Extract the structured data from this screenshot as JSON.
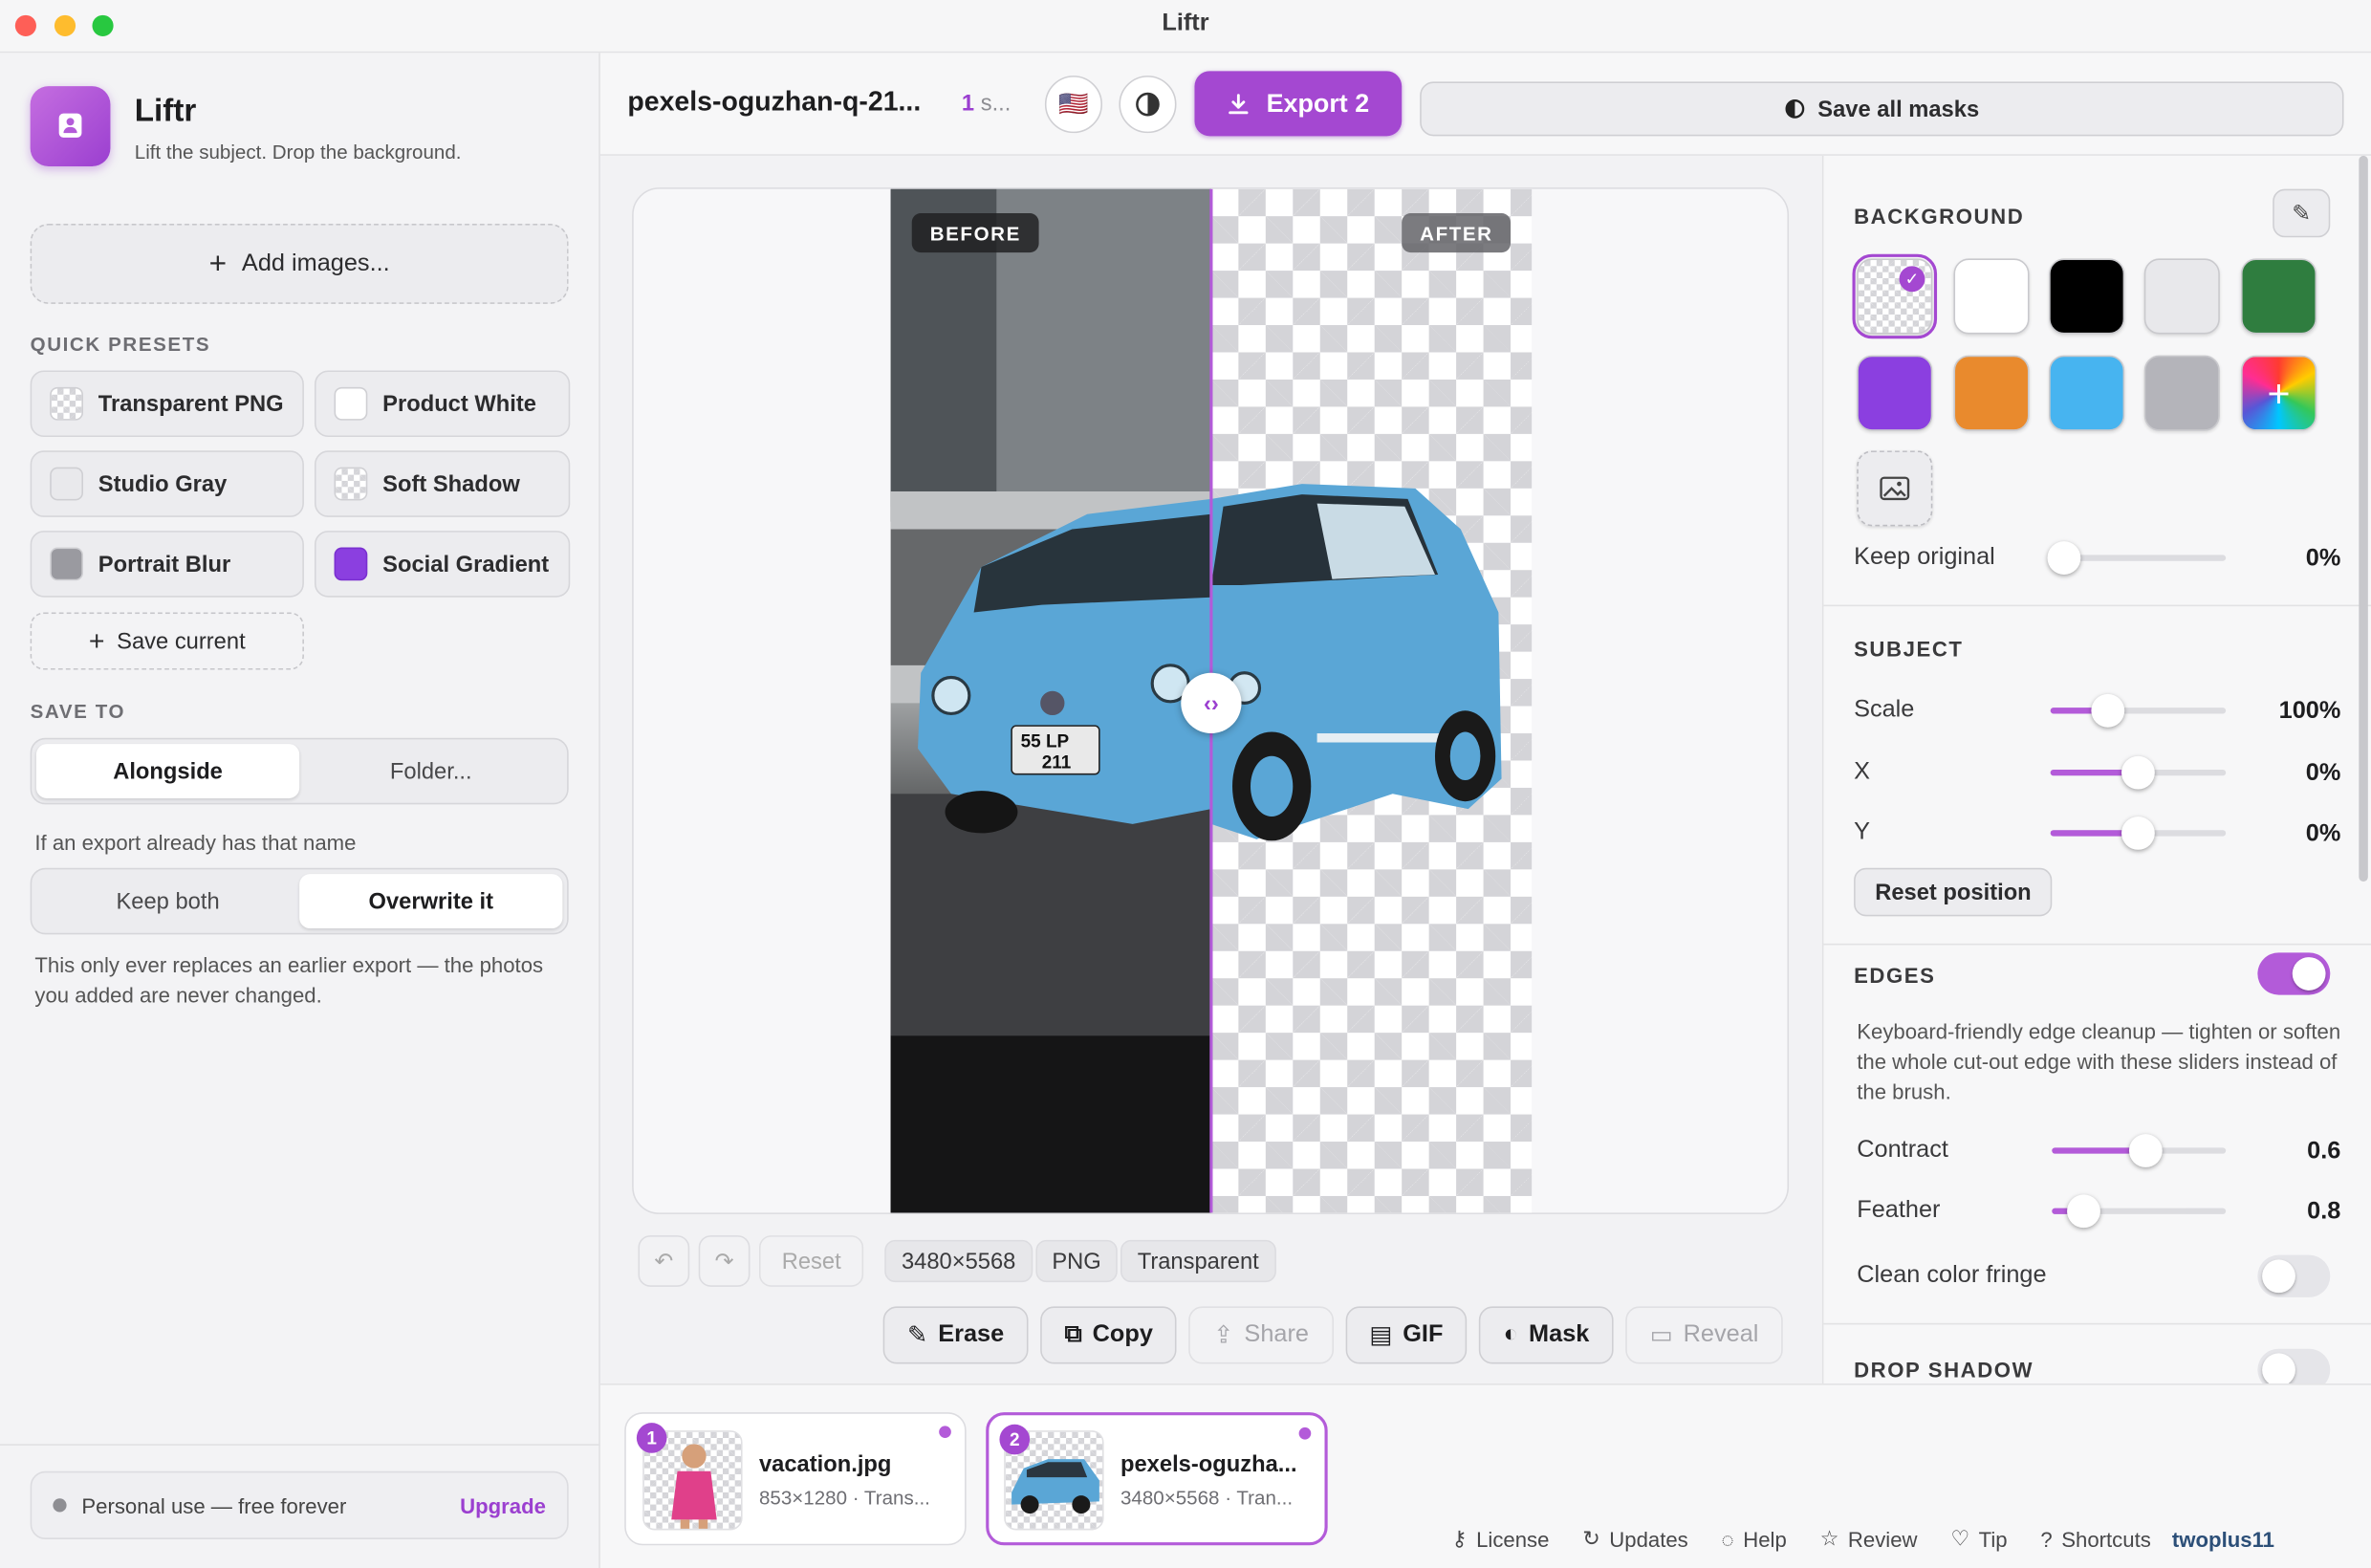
{
  "window": {
    "title": "Liftr"
  },
  "app": {
    "name": "Liftr",
    "tagline": "Lift the subject. Drop the background."
  },
  "sidebar": {
    "add_images": "Add images...",
    "quick_presets_label": "QUICK PRESETS",
    "presets": [
      {
        "label": "Transparent PNG",
        "swatch": "checker"
      },
      {
        "label": "Product White",
        "swatch": "#ffffff"
      },
      {
        "label": "Studio Gray",
        "swatch": "#e9e9ec"
      },
      {
        "label": "Soft Shadow",
        "swatch": "checker"
      },
      {
        "label": "Portrait Blur",
        "swatch": "#9a9aa0"
      },
      {
        "label": "Social Gradient",
        "swatch": "#8b3fe0"
      }
    ],
    "save_current": "Save current",
    "save_to_label": "SAVE TO",
    "save_to_options": [
      "Alongside",
      "Folder..."
    ],
    "save_to_selected": "Alongside",
    "conflict_label": "If an export already has that name",
    "conflict_options": [
      "Keep both",
      "Overwrite it"
    ],
    "conflict_selected": "Overwrite it",
    "conflict_note": "This only ever replaces an earlier export — the photos you added are never changed.",
    "license_status": "Personal use — free forever",
    "upgrade": "Upgrade"
  },
  "toolbar": {
    "file_title": "pexels-oguzhan-q-21...",
    "count_num": "1",
    "count_suffix": "s...",
    "flag": "🇺🇸",
    "export_label": "Export 2",
    "save_all_masks": "Save all masks"
  },
  "canvas": {
    "before_label": "BEFORE",
    "after_label": "AFTER",
    "plate_line1": "55  LP",
    "plate_line2": "211"
  },
  "meta": {
    "reset": "Reset",
    "dimensions": "3480×5568",
    "format": "PNG",
    "background": "Transparent"
  },
  "actions": {
    "erase": "Erase",
    "copy": "Copy",
    "share": "Share",
    "gif": "GIF",
    "mask": "Mask",
    "reveal": "Reveal"
  },
  "panel": {
    "background_label": "BACKGROUND",
    "bg_swatches": [
      "checker",
      "#ffffff",
      "#000000",
      "#e8e8eb",
      "#2f7d3f",
      "#8b3fe0",
      "#e98a2d",
      "#47b4f0",
      "#b4b4ba",
      "rainbow"
    ],
    "keep_original_label": "Keep original",
    "keep_original_value": "0%",
    "keep_original_level": 0,
    "subject_label": "SUBJECT",
    "scale_label": "Scale",
    "scale_value": "100%",
    "x_label": "X",
    "x_value": "0%",
    "y_label": "Y",
    "y_value": "0%",
    "reset_position": "Reset position",
    "edges_label": "EDGES",
    "edges_on": true,
    "edges_desc": "Keyboard-friendly edge cleanup — tighten or soften the whole cut-out edge with these sliders instead of the brush.",
    "contract_label": "Contract",
    "contract_value": "0.6",
    "feather_label": "Feather",
    "feather_value": "0.8",
    "fringe_label": "Clean color fringe",
    "fringe_on": false,
    "drop_shadow_label": "DROP SHADOW",
    "drop_shadow_on": false
  },
  "thumbnails": [
    {
      "num": "1",
      "name": "vacation.jpg",
      "meta": "853×1280 · Trans..."
    },
    {
      "num": "2",
      "name": "pexels-oguzha...",
      "meta": "3480×5568 · Tran..."
    }
  ],
  "footer_links": [
    "License",
    "Updates",
    "Help",
    "Review",
    "Tip",
    "Shortcuts"
  ],
  "brand": "twoplus11"
}
